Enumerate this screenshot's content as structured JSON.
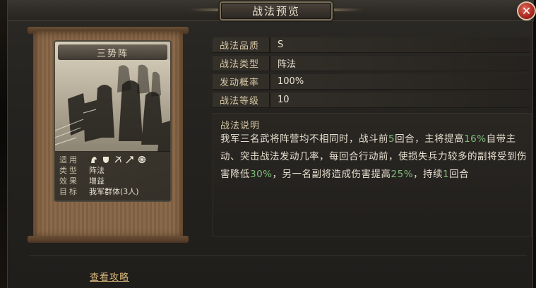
{
  "dialog": {
    "title": "战法预览",
    "close_label": "✕"
  },
  "card": {
    "name": "三势阵",
    "info": [
      {
        "key": "适用",
        "value": ""
      },
      {
        "key": "类型",
        "value": "阵法"
      },
      {
        "key": "效果",
        "value": "增益"
      },
      {
        "key": "目标",
        "value": "我军群体(3人)"
      }
    ],
    "unit_icons": [
      "cavalry-icon",
      "shield-icon",
      "bow-icon",
      "spear-icon",
      "siege-icon"
    ]
  },
  "attributes": [
    {
      "key": "战法品质",
      "value": "S"
    },
    {
      "key": "战法类型",
      "value": "阵法"
    },
    {
      "key": "发动概率",
      "value": "100%"
    },
    {
      "key": "战法等级",
      "value": "10"
    }
  ],
  "description": {
    "label": "战法说明",
    "segments": [
      {
        "text": "我军三名武将阵营均不相同时，战斗前",
        "hl": false
      },
      {
        "text": "5",
        "hl": true
      },
      {
        "text": "回合，主将提高",
        "hl": false
      },
      {
        "text": "16%",
        "hl": true
      },
      {
        "text": "自带主动、突击战法发动几率，每回合行动前，使损失兵力较多的副将受到伤害降低",
        "hl": false
      },
      {
        "text": "30%",
        "hl": true
      },
      {
        "text": "，另一名副将造成伤害提高",
        "hl": false
      },
      {
        "text": "25%",
        "hl": true
      },
      {
        "text": "，持续",
        "hl": false
      },
      {
        "text": "1",
        "hl": true
      },
      {
        "text": "回合",
        "hl": false
      }
    ]
  },
  "footer": {
    "guide_label": "查看攻略"
  },
  "colors": {
    "highlight": "#7fbf78",
    "label_gold": "#d7c7a5",
    "link": "#d8b77a"
  }
}
